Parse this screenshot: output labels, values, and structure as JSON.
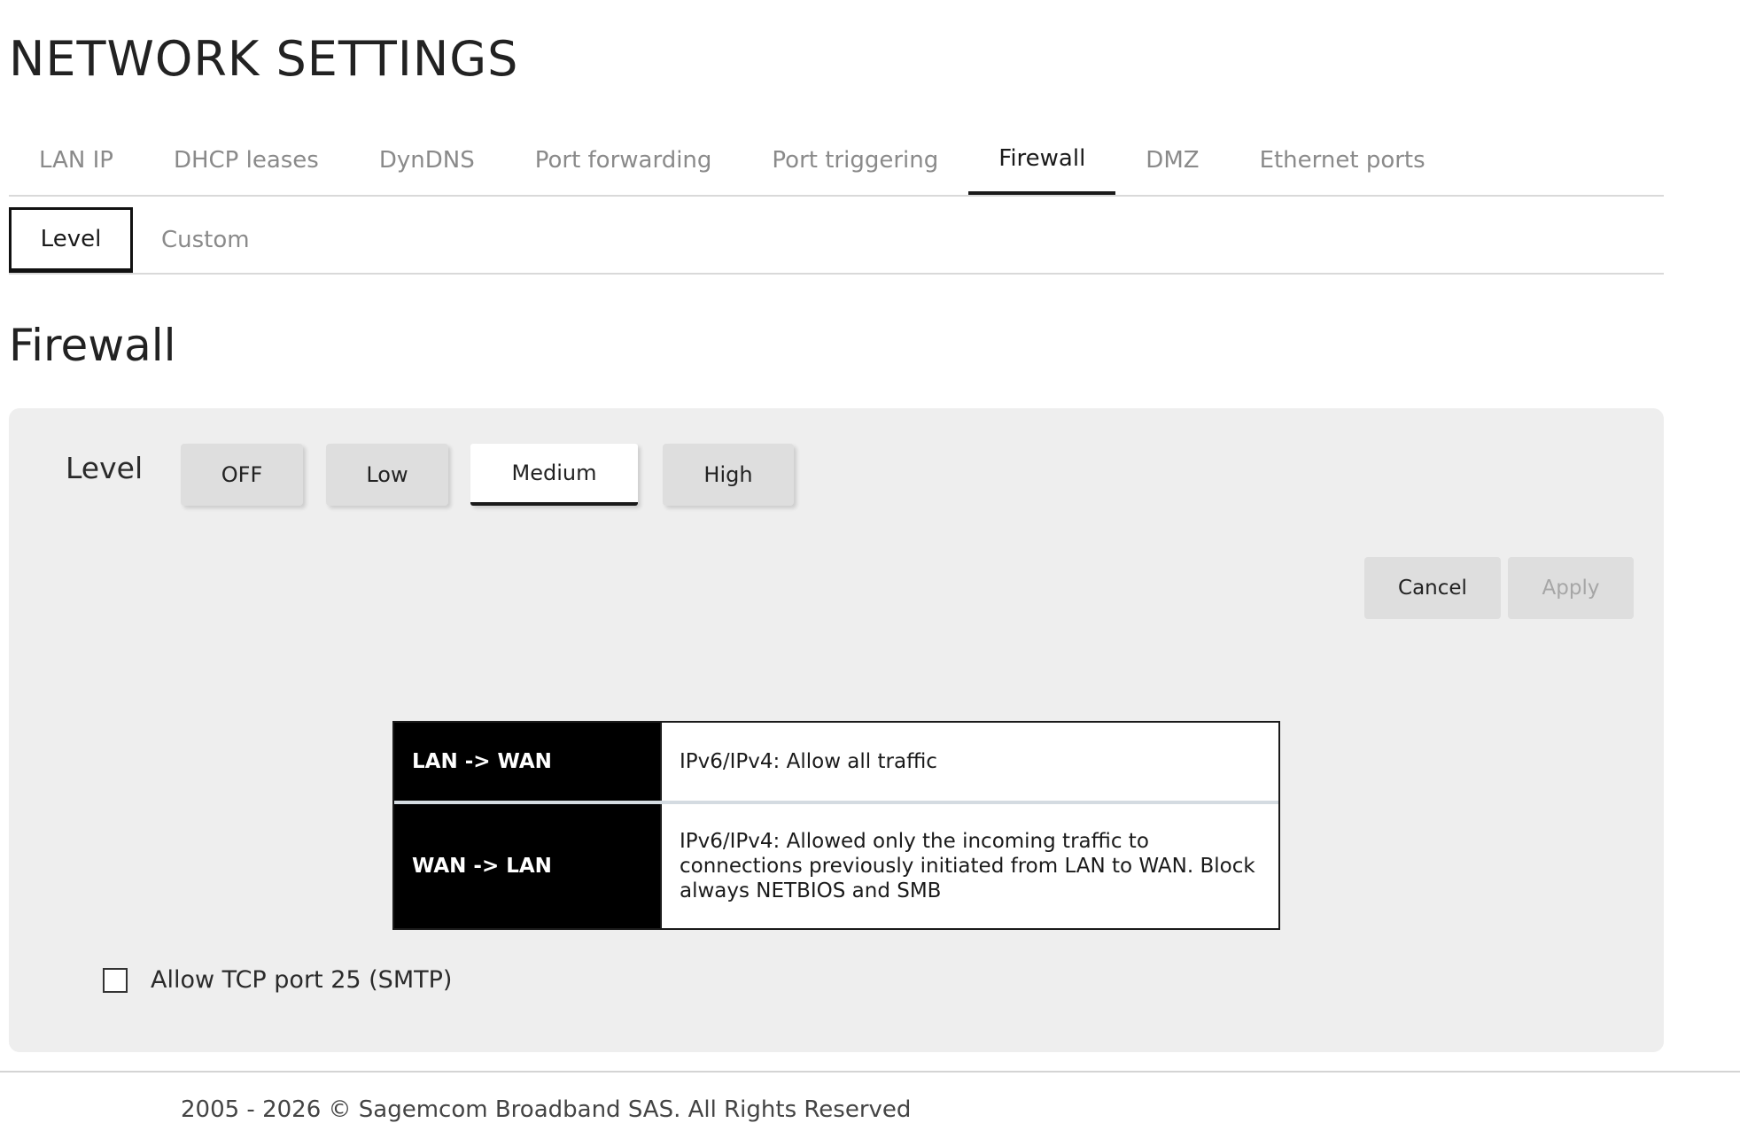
{
  "page_title": "NETWORK SETTINGS",
  "main_tabs": [
    {
      "label": "LAN IP"
    },
    {
      "label": "DHCP leases"
    },
    {
      "label": "DynDNS"
    },
    {
      "label": "Port forwarding"
    },
    {
      "label": "Port triggering"
    },
    {
      "label": "Firewall",
      "active": true
    },
    {
      "label": "DMZ"
    },
    {
      "label": "Ethernet ports"
    }
  ],
  "sub_tabs": [
    {
      "label": "Level",
      "active": true
    },
    {
      "label": "Custom"
    }
  ],
  "section_title": "Firewall",
  "level": {
    "label": "Level",
    "options": [
      "OFF",
      "Low",
      "Medium",
      "High"
    ],
    "selected": "Medium"
  },
  "actions": {
    "cancel_label": "Cancel",
    "apply_label": "Apply",
    "apply_disabled": true
  },
  "rules": [
    {
      "direction": "LAN -> WAN",
      "description": "IPv6/IPv4: Allow all traffic"
    },
    {
      "direction": "WAN -> LAN",
      "description": "IPv6/IPv4: Allowed only the incoming traffic to connections previously initiated from LAN to WAN. Block always NETBIOS and SMB"
    }
  ],
  "smtp": {
    "label": "Allow TCP port 25 (SMTP)",
    "checked": false
  },
  "footer": {
    "text": "2005 - 2026 © Sagemcom Broadband SAS. All Rights Reserved"
  },
  "colors": {
    "panel_bg": "#eeeeee",
    "button_bg": "#dedede",
    "active_underline": "#1a1a1a",
    "rule_head_bg": "#000000"
  }
}
